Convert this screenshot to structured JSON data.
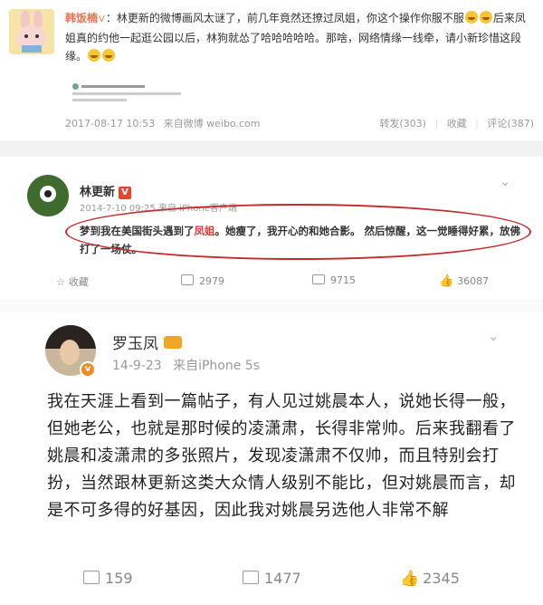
{
  "post1": {
    "author": "韩饭楠",
    "vip_mark": "V",
    "text_before_emoji": "：林更新的微博画风太谜了，前几年竟然还撩过凤姐，你这个操作你服不服",
    "text_after_emoji": "后来凤姐真的约他一起逛公园以后，林狗就怂了哈哈哈哈哈。那啥，网络情缘一线牵，请小新珍惜这段缘。",
    "time": "2017-08-17 10:53",
    "source": "来自微博 weibo.com",
    "repost": "转发(303)",
    "favorite": "收藏",
    "comment": "评论(387)"
  },
  "post2": {
    "author": "林更新",
    "vip_mark": "V",
    "time": "2014-7-10 09:25 来自 iPhone客户端",
    "text_before_hl": "梦到我在美国街头遇到了",
    "highlight": "凤姐",
    "text_after_hl": "。她瘦了，我开心的和她合影。 然后惊醒，这一觉睡得好累，放佛打了一场仗。",
    "favorite": "收藏",
    "reposts": "2979",
    "comments": "9715",
    "likes": "36087"
  },
  "post3": {
    "author": "罗玉凤",
    "verified_mark": "v",
    "time": "14-9-23",
    "source": "来自iPhone 5s",
    "text": "我在天涯上看到一篇帖子，有人见过姚晨本人，说她长得一般，但她老公，也就是那时候的凌潇肃，长得非常帅。后来我翻看了姚晨和凌潇肃的多张照片，发现凌潇肃不仅帅，而且特别会打扮，当然跟林更新这类大众情人级别不能比，但对姚晨而言，却是不可多得的好基因，因此我对姚晨另选他人非常不解",
    "reposts": "159",
    "comments": "1477",
    "likes": "2345"
  },
  "icons": {
    "chevron": "⌄",
    "star": "☆",
    "thumb": "👍"
  },
  "colors": {
    "username": "#eb7350",
    "highlight": "#e33333",
    "oval": "#c52a2a"
  }
}
